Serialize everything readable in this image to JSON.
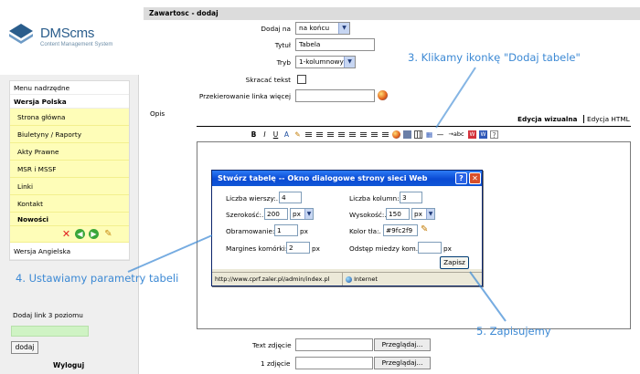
{
  "logo": {
    "name": "DMScms",
    "tagline": "Content Management System"
  },
  "sidebar": {
    "items": [
      {
        "label": "Menu nadrzędne",
        "style": "plain"
      },
      {
        "label": "Wersja Polska",
        "style": "bold"
      },
      {
        "label": "Strona główna",
        "style": "yellow"
      },
      {
        "label": "Biuletyny / Raporty",
        "style": "yellow"
      },
      {
        "label": "Akty Prawne",
        "style": "yellow"
      },
      {
        "label": "MSR i MSSF",
        "style": "yellow"
      },
      {
        "label": "Linki",
        "style": "yellow"
      },
      {
        "label": "Kontakt",
        "style": "yellow"
      },
      {
        "label": "Nowości",
        "style": "yellow-bold"
      }
    ],
    "english": "Wersja Angielska",
    "level3_label": "Dodaj link 3 poziomu",
    "add_button": "dodaj",
    "logout": "Wyloguj"
  },
  "form": {
    "header": "Zawartosc - dodaj",
    "add_on_label": "Dodaj na",
    "add_on_value": "na końcu",
    "title_label": "Tytuł",
    "title_value": "Tabela",
    "mode_label": "Tryb",
    "mode_value": "1-kolumnowy",
    "shorten_label": "Skracać tekst",
    "redirect_label": "Przekierowanie linka więcej",
    "description_label": "Opis",
    "tab_visual": "Edycja wizualna",
    "tab_html": "Edycja HTML",
    "text_photo_label": "Text zdjęcie",
    "photo1_label": "1 zdjęcie",
    "browse_label": "Przeglądaj..."
  },
  "toolbar": {
    "bold": "B",
    "italic": "I",
    "underline": "U",
    "font": "A",
    "strike": "abc",
    "word1": "W",
    "word2": "W",
    "help": "?"
  },
  "dialog": {
    "title": "Stwórz tabelę -- Okno dialogowe strony sieci Web",
    "help": "?",
    "close": "✕",
    "rows_label": "Liczba wierszy:.",
    "rows_value": "4",
    "cols_label": "Liczba kolumn:.",
    "cols_value": "3",
    "width_label": "Szerokość:.",
    "width_value": "200",
    "width_unit": "px",
    "height_label": "Wysokość:.",
    "height_value": "150",
    "height_unit": "px",
    "border_label": "Obramowanie:.",
    "border_value": "1",
    "border_unit": "px",
    "bg_label": "Kolor tła:.",
    "bg_value": "#9fc2f9",
    "padding_label": "Margines komórki:.",
    "padding_value": "2",
    "padding_unit": "px",
    "spacing_label": "Odstęp miedzy kom.:.",
    "spacing_unit": "px",
    "save": "Zapisz",
    "status_url": "http://www.cprf.zaler.pl/admin/index.pl",
    "status_zone": "Internet"
  },
  "annotations": {
    "step3": "3. Klikamy ikonkę \"Dodaj tabele\"",
    "step4": "4. Ustawiamy parametry tabeli",
    "step5": "5. Zapisujemy"
  },
  "colors": {
    "menu_yellow": "#fefdb8",
    "annotation_blue": "#3c89d4",
    "dialog_title_blue": "#0a4ad4",
    "level3_input_green": "#cff3c4"
  }
}
